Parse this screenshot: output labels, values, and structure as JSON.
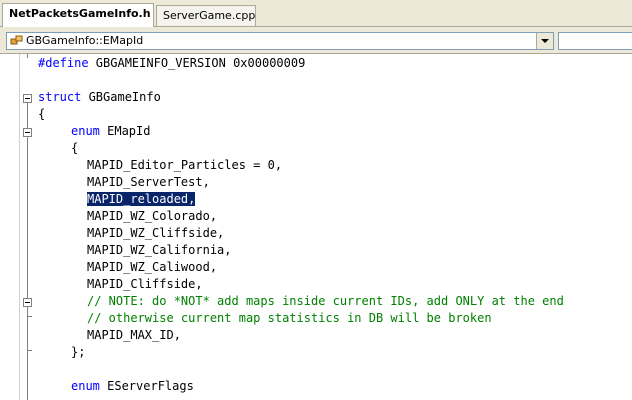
{
  "tabs": [
    {
      "label": "NetPacketsGameInfo.h",
      "active": true
    },
    {
      "label": "ServerGame.cpp",
      "active": false
    }
  ],
  "navigation": {
    "scope_combo_value": "GBGameInfo::EMapId",
    "member_combo_value": ""
  },
  "code": {
    "define_kw": "#define",
    "define_rest": " GBGAMEINFO_VERSION 0x00000009",
    "struct_kw": "struct",
    "struct_rest": " GBGameInfo",
    "open_brace_1": "{",
    "enum1_kw": "enum",
    "enum1_rest": " EMapId",
    "open_brace_2": "{",
    "line_particles": "MAPID_Editor_Particles = 0,",
    "line_servertest": "MAPID_ServerTest,",
    "line_reloaded_selected": "MAPID_reloaded,",
    "line_colorado": "MAPID_WZ_Colorado,",
    "line_cliffside_wz": "MAPID_WZ_Cliffside,",
    "line_california": "MAPID_WZ_California,",
    "line_caliwood": "MAPID_WZ_Caliwood,",
    "line_cliffside": "MAPID_Cliffside,",
    "comment_1": "// NOTE: do *NOT* add maps inside current IDs, add ONLY at the end",
    "comment_2": "// otherwise current map statistics in DB will be broken",
    "line_max_id": "MAPID_MAX_ID,",
    "close_brace_2": "};",
    "enum2_kw": "enum",
    "enum2_rest": " EServerFlags"
  },
  "colors": {
    "keyword": "#0000ff",
    "comment": "#008000",
    "selection_bg": "#0a246a",
    "selection_fg": "#ffffff"
  }
}
